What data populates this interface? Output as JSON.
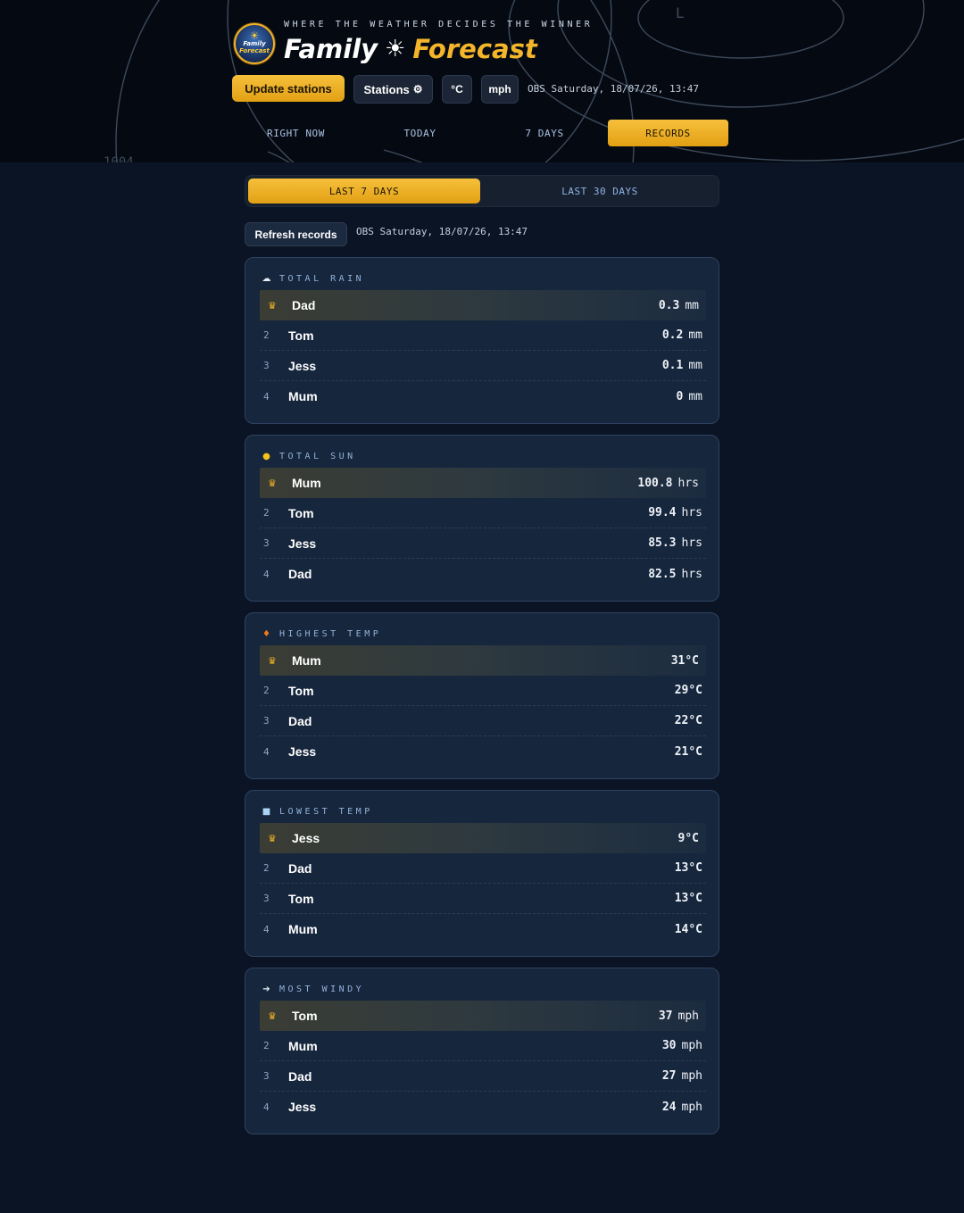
{
  "header": {
    "tagline": "WHERE THE WEATHER DECIDES THE WINNER",
    "brand_word1": "Family",
    "brand_sun": "☀",
    "brand_word2": "Forecast",
    "logo_text1": "Family",
    "logo_text2": "Forecast",
    "map_label_pressure": "1004",
    "map_label_low": "L",
    "buttons": {
      "update": "Update stations",
      "stations": "Stations",
      "stations_icon": "gear-icon",
      "celsius": "°C",
      "mph": "mph"
    },
    "obs": "OBS Saturday, 18/07/26, 13:47",
    "nav": [
      {
        "label": "RIGHT NOW",
        "active": false
      },
      {
        "label": "TODAY",
        "active": false
      },
      {
        "label": "7 DAYS",
        "active": false
      },
      {
        "label": "RECORDS",
        "active": true
      }
    ]
  },
  "records": {
    "period_tabs": [
      {
        "label": "LAST 7 DAYS",
        "active": true
      },
      {
        "label": "LAST 30 DAYS",
        "active": false
      }
    ],
    "refresh_label": "Refresh records",
    "obs": "OBS Saturday, 18/07/26, 13:47",
    "leader_icon": "crown-icon",
    "cards": [
      {
        "title": "TOTAL RAIN",
        "icon": "cloud-icon",
        "icon_glyph": "☁",
        "icon_color": "#e8edf5",
        "rows": [
          {
            "rank": "1",
            "name": "Dad",
            "value": "0.3",
            "unit": "mm"
          },
          {
            "rank": "2",
            "name": "Tom",
            "value": "0.2",
            "unit": "mm"
          },
          {
            "rank": "3",
            "name": "Jess",
            "value": "0.1",
            "unit": "mm"
          },
          {
            "rank": "4",
            "name": "Mum",
            "value": "0",
            "unit": "mm"
          }
        ]
      },
      {
        "title": "TOTAL SUN",
        "icon": "sun-icon",
        "icon_glyph": "●",
        "icon_color": "#f6c21c",
        "rows": [
          {
            "rank": "1",
            "name": "Mum",
            "value": "100.8",
            "unit": "hrs"
          },
          {
            "rank": "2",
            "name": "Tom",
            "value": "99.4",
            "unit": "hrs"
          },
          {
            "rank": "3",
            "name": "Jess",
            "value": "85.3",
            "unit": "hrs"
          },
          {
            "rank": "4",
            "name": "Dad",
            "value": "82.5",
            "unit": "hrs"
          }
        ]
      },
      {
        "title": "HIGHEST TEMP",
        "icon": "flame-icon",
        "icon_glyph": "♦",
        "icon_color": "#f07a1a",
        "rows": [
          {
            "rank": "1",
            "name": "Mum",
            "value": "31°C",
            "unit": ""
          },
          {
            "rank": "2",
            "name": "Tom",
            "value": "29°C",
            "unit": ""
          },
          {
            "rank": "3",
            "name": "Dad",
            "value": "22°C",
            "unit": ""
          },
          {
            "rank": "4",
            "name": "Jess",
            "value": "21°C",
            "unit": ""
          }
        ]
      },
      {
        "title": "LOWEST TEMP",
        "icon": "ice-cube-icon",
        "icon_glyph": "■",
        "icon_color": "#a9d4f2",
        "rows": [
          {
            "rank": "1",
            "name": "Jess",
            "value": "9°C",
            "unit": ""
          },
          {
            "rank": "2",
            "name": "Dad",
            "value": "13°C",
            "unit": ""
          },
          {
            "rank": "3",
            "name": "Tom",
            "value": "13°C",
            "unit": ""
          },
          {
            "rank": "4",
            "name": "Mum",
            "value": "14°C",
            "unit": ""
          }
        ]
      },
      {
        "title": "MOST WINDY",
        "icon": "wind-icon",
        "icon_glyph": "➔",
        "icon_color": "#e8edf5",
        "rows": [
          {
            "rank": "1",
            "name": "Tom",
            "value": "37",
            "unit": "mph"
          },
          {
            "rank": "2",
            "name": "Mum",
            "value": "30",
            "unit": "mph"
          },
          {
            "rank": "3",
            "name": "Dad",
            "value": "27",
            "unit": "mph"
          },
          {
            "rank": "4",
            "name": "Jess",
            "value": "24",
            "unit": "mph"
          }
        ]
      }
    ]
  }
}
